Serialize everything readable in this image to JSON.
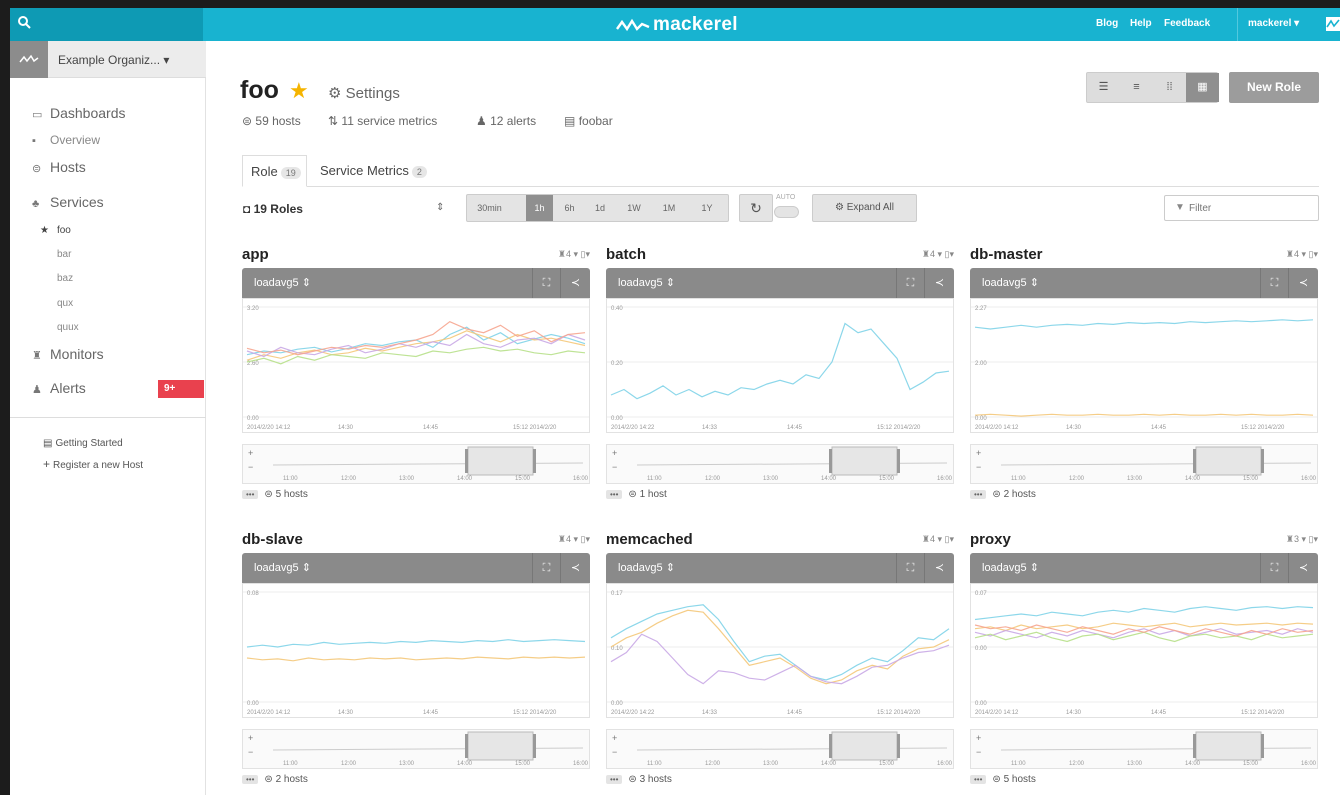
{
  "topbar": {
    "logo_text": "mackerel",
    "links": [
      "Blog",
      "Help",
      "Feedback"
    ],
    "user": "mackerel ▾"
  },
  "sidebar": {
    "org_name": "Example Organiz...  ▾",
    "nav": {
      "dashboards": "Dashboards",
      "overview": "Overview",
      "hosts": "Hosts",
      "services": "Services",
      "monitors": "Monitors",
      "alerts": "Alerts"
    },
    "service_items": [
      "foo",
      "bar",
      "baz",
      "qux",
      "quux"
    ],
    "alert_count": "9+",
    "getting_started": "Getting Started",
    "register_host": "Register a new Host"
  },
  "header": {
    "title": "foo",
    "settings_label": "Settings",
    "hosts": "59 hosts",
    "service_metrics": "11 service metrics",
    "alerts": "12 alerts",
    "memo": "foobar",
    "new_role_label": "New Role"
  },
  "tabs": {
    "role_label": "Role",
    "role_count": "19",
    "service_metrics_label": "Service Metrics",
    "service_metrics_count": "2"
  },
  "toolbar": {
    "roles_count": "19 Roles",
    "ranges": [
      "30min",
      "1h",
      "6h",
      "1d",
      "1W",
      "1M",
      "1Y"
    ],
    "active_range": "1h",
    "auto_label": "AUTO",
    "expand_label": "Expand All",
    "filter_placeholder": "Filter"
  },
  "colors": {
    "brand": "#18b3d0",
    "alert": "#e9414e",
    "star": "#f5b400",
    "series": [
      "#7fd3e8",
      "#f4c87a",
      "#c9a9e6",
      "#b7e08a",
      "#f6a58f"
    ]
  },
  "panels": [
    {
      "title": "app",
      "host_count": "4",
      "metric": "loadavg5",
      "footer": "5 hosts",
      "y_ticks": [
        "3.20",
        "2.60",
        "0.00"
      ],
      "x_ticks": [
        "2014/2/20 14:12",
        "14:30",
        "14:45",
        "15:12 2014/2/20"
      ],
      "nav_ticks": [
        "11:00",
        "12:00",
        "13:00",
        "14:00",
        "15:00",
        "16:00"
      ],
      "series": [
        [
          52,
          48,
          50,
          46,
          44,
          49,
          45,
          40,
          42,
          38,
          36,
          44,
          30,
          22,
          36,
          28,
          40,
          35,
          30,
          34,
          40
        ],
        [
          58,
          52,
          56,
          50,
          47,
          52,
          50,
          45,
          48,
          44,
          40,
          38,
          34,
          26,
          32,
          38,
          30,
          36,
          34,
          38,
          42
        ],
        [
          48,
          54,
          44,
          50,
          52,
          46,
          42,
          50,
          46,
          40,
          44,
          38,
          42,
          30,
          40,
          44,
          36,
          34,
          40,
          30,
          36
        ],
        [
          60,
          56,
          62,
          54,
          58,
          52,
          54,
          56,
          50,
          52,
          54,
          48,
          50,
          46,
          44,
          48,
          46,
          50,
          52,
          48,
          50
        ],
        [
          45,
          50,
          47,
          52,
          48,
          44,
          46,
          42,
          44,
          40,
          36,
          30,
          16,
          24,
          28,
          20,
          32,
          26,
          38,
          30,
          28
        ]
      ]
    },
    {
      "title": "batch",
      "host_count": "4",
      "metric": "loadavg5",
      "footer": "1 host",
      "y_ticks": [
        "0.40",
        "0.20",
        "0.00"
      ],
      "x_ticks": [
        "2014/2/20 14:22",
        "14:33",
        "14:45",
        "15:12 2014/2/20"
      ],
      "nav_ticks": [
        "11:00",
        "12:00",
        "13:00",
        "14:00",
        "15:00",
        "16:00"
      ],
      "series": [
        [
          96,
          90,
          100,
          94,
          86,
          96,
          90,
          98,
          92,
          96,
          88,
          90,
          84,
          80,
          84,
          74,
          78,
          60,
          18,
          28,
          24,
          40,
          56,
          90,
          82,
          72,
          70
        ]
      ]
    },
    {
      "title": "db-master",
      "host_count": "4",
      "metric": "loadavg5",
      "footer": "2 hosts",
      "y_ticks": [
        "2.27",
        "2.00",
        "0.00"
      ],
      "x_ticks": [
        "2014/2/20 14:12",
        "14:30",
        "14:45",
        "15:12 2014/2/20"
      ],
      "nav_ticks": [
        "11:00",
        "12:00",
        "13:00",
        "14:00",
        "15:00",
        "16:00"
      ],
      "series": [
        [
          22,
          24,
          22,
          20,
          22,
          20,
          19,
          20,
          18,
          19,
          17,
          18,
          17,
          18,
          16,
          17,
          16,
          15,
          16,
          15,
          14,
          15,
          14
        ],
        [
          118,
          117,
          118,
          119,
          118,
          117,
          118,
          118,
          117,
          118,
          118,
          117,
          118,
          117,
          118,
          118,
          117,
          118,
          117,
          118,
          118,
          117,
          118
        ]
      ]
    },
    {
      "title": "db-slave",
      "host_count": "4",
      "metric": "loadavg5",
      "footer": "2 hosts",
      "y_ticks": [
        "0.08",
        "0.00"
      ],
      "x_ticks": [
        "2014/2/20 14:12",
        "14:30",
        "14:45",
        "15:12 2014/2/20"
      ],
      "nav_ticks": [
        "11:00",
        "12:00",
        "13:00",
        "14:00",
        "15:00",
        "16:00"
      ],
      "series": [
        [
          60,
          58,
          60,
          57,
          58,
          55,
          57,
          56,
          55,
          56,
          54,
          55,
          53,
          54,
          55,
          53,
          54,
          52,
          54,
          53,
          52,
          53,
          54
        ],
        [
          72,
          74,
          73,
          75,
          72,
          74,
          73,
          74,
          72,
          73,
          72,
          74,
          73,
          72,
          73,
          71,
          72,
          73,
          71,
          72,
          71,
          72,
          71
        ]
      ]
    },
    {
      "title": "memcached",
      "host_count": "4",
      "metric": "loadavg5",
      "footer": "3 hosts",
      "y_ticks": [
        "0.17",
        "0.10",
        "0.00"
      ],
      "x_ticks": [
        "2014/2/20 14:22",
        "14:33",
        "14:45",
        "15:12 2014/2/20"
      ],
      "nav_ticks": [
        "11:00",
        "12:00",
        "13:00",
        "14:00",
        "15:00",
        "16:00"
      ],
      "series": [
        [
          50,
          40,
          32,
          24,
          20,
          16,
          14,
          30,
          54,
          76,
          70,
          68,
          80,
          92,
          96,
          90,
          80,
          72,
          76,
          64,
          50,
          52,
          40
        ],
        [
          60,
          50,
          44,
          34,
          26,
          20,
          22,
          40,
          60,
          80,
          76,
          72,
          82,
          94,
          100,
          96,
          86,
          80,
          84,
          70,
          62,
          60,
          52
        ],
        [
          76,
          66,
          46,
          54,
          72,
          90,
          100,
          86,
          88,
          94,
          96,
          88,
          80,
          92,
          98,
          100,
          92,
          82,
          80,
          72,
          66,
          64,
          58
        ]
      ]
    },
    {
      "title": "proxy",
      "host_count": "3",
      "metric": "loadavg5",
      "footer": "5 hosts",
      "y_ticks": [
        "0.07",
        "0.00",
        "0.00"
      ],
      "x_ticks": [
        "2014/2/20 14:12",
        "14:30",
        "14:45",
        "15:12 2014/2/20"
      ],
      "nav_ticks": [
        "11:00",
        "12:00",
        "13:00",
        "14:00",
        "15:00",
        "16:00"
      ],
      "series": [
        [
          30,
          28,
          26,
          24,
          26,
          22,
          24,
          26,
          22,
          20,
          22,
          18,
          20,
          22,
          18,
          16,
          18,
          20,
          17,
          16,
          18,
          16,
          17
        ],
        [
          40,
          38,
          42,
          36,
          40,
          38,
          36,
          40,
          38,
          34,
          36,
          38,
          36,
          34,
          38,
          36,
          34,
          36,
          35,
          34,
          36,
          34,
          35
        ],
        [
          44,
          48,
          42,
          46,
          50,
          44,
          48,
          42,
          46,
          50,
          44,
          40,
          46,
          42,
          48,
          44,
          40,
          46,
          44,
          42,
          46,
          40,
          44
        ],
        [
          50,
          46,
          52,
          48,
          44,
          50,
          54,
          48,
          46,
          52,
          48,
          44,
          50,
          54,
          48,
          46,
          50,
          48,
          52,
          46,
          50,
          48,
          46
        ],
        [
          36,
          40,
          38,
          42,
          36,
          40,
          44,
          38,
          42,
          46,
          40,
          44,
          38,
          42,
          46,
          40,
          44,
          48,
          42,
          46,
          40,
          44,
          42
        ]
      ]
    }
  ]
}
